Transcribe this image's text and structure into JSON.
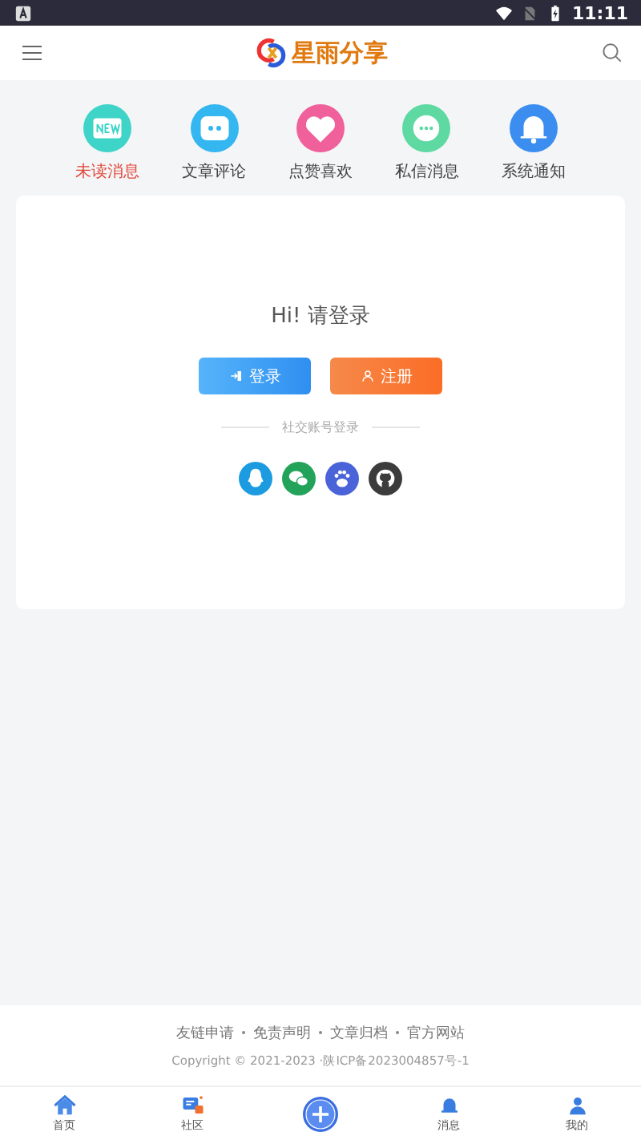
{
  "status_bar": {
    "time": "11:11"
  },
  "header": {
    "logo_text": "星雨分享"
  },
  "shortcuts": [
    {
      "label": "未读消息",
      "selected": true,
      "color": "#3fd4c8"
    },
    {
      "label": "文章评论",
      "selected": false,
      "color": "#34b6f0"
    },
    {
      "label": "点赞喜欢",
      "selected": false,
      "color": "#f0609a"
    },
    {
      "label": "私信消息",
      "selected": false,
      "color": "#5ed9a2"
    },
    {
      "label": "系统通知",
      "selected": false,
      "color": "#3b8ef0"
    }
  ],
  "login_card": {
    "greeting": "Hi!  请登录",
    "buttons": [
      {
        "kind": "login",
        "label": "登录"
      },
      {
        "kind": "register",
        "label": "注册"
      }
    ],
    "social_label": "社交账号登录",
    "social": [
      {
        "kind": "qq",
        "color": "#1d9be0"
      },
      {
        "kind": "wechat",
        "color": "#23a35a"
      },
      {
        "kind": "baidu",
        "color": "#4a63d9"
      },
      {
        "kind": "github",
        "color": "#3c3c3c"
      }
    ]
  },
  "footer": {
    "links": [
      "友链申请",
      "免责声明",
      "文章归档",
      "官方网站"
    ],
    "copyright": "Copyright © 2021-2023 ·陕ICP备2023004857号-1"
  },
  "bottom_nav": [
    {
      "kind": "home",
      "label": "首页"
    },
    {
      "kind": "community",
      "label": "社区"
    },
    {
      "kind": "add"
    },
    {
      "kind": "message",
      "label": "消息"
    },
    {
      "kind": "me",
      "label": "我的"
    }
  ]
}
